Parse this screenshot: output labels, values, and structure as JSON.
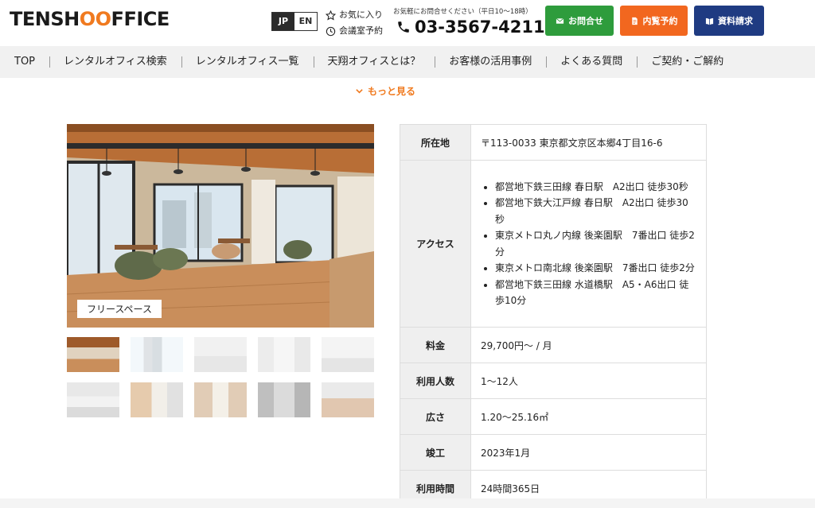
{
  "header": {
    "logo": {
      "part1": "TENSH",
      "part2": "OO",
      "part3": "FFICE"
    },
    "lang": {
      "jp": "JP",
      "en": "EN"
    },
    "favorites_label": "お気に入り",
    "room_booking_label": "会議室予約",
    "tel_note": "お気軽にお問合せください（平日10〜18時）",
    "tel": "03-3567-4211",
    "buttons": {
      "contact": "お問合せ",
      "viewing": "内覧予約",
      "docs": "資料請求"
    },
    "colors": {
      "green": "#2e9c3c",
      "orange": "#f2671f",
      "navy": "#1f3b82",
      "accent": "#f07a1f"
    }
  },
  "nav": {
    "items": [
      "TOP",
      "レンタルオフィス検索",
      "レンタルオフィス一覧",
      "天翔オフィスとは？",
      "お客様の活用事例",
      "よくある質問",
      "ご契約・ご解約"
    ]
  },
  "more_label": "もっと見る",
  "gallery": {
    "caption": "フリースペース",
    "thumbnail_count": 10
  },
  "info": {
    "rows": [
      {
        "key": "所在地",
        "value": "〒113-0033 東京都文京区本郷4丁目16-6"
      },
      {
        "key": "アクセス",
        "items": [
          "都営地下鉄三田線 春日駅　A2出口 徒歩30秒",
          "都営地下鉄大江戸線 春日駅　A2出口 徒歩30秒",
          "東京メトロ丸ノ内線 後楽園駅　7番出口 徒歩2分",
          "東京メトロ南北線 後楽園駅　7番出口 徒歩2分",
          "都営地下鉄三田線 水道橋駅　A5・A6出口 徒歩10分"
        ]
      },
      {
        "key": "料金",
        "value": "29,700円〜 / 月"
      },
      {
        "key": "利用人数",
        "value": "1〜12人"
      },
      {
        "key": "広さ",
        "value": "1.20〜25.16㎡"
      },
      {
        "key": "竣工",
        "value": "2023年1月"
      },
      {
        "key": "利用時間",
        "value": "24時間365日"
      }
    ]
  }
}
